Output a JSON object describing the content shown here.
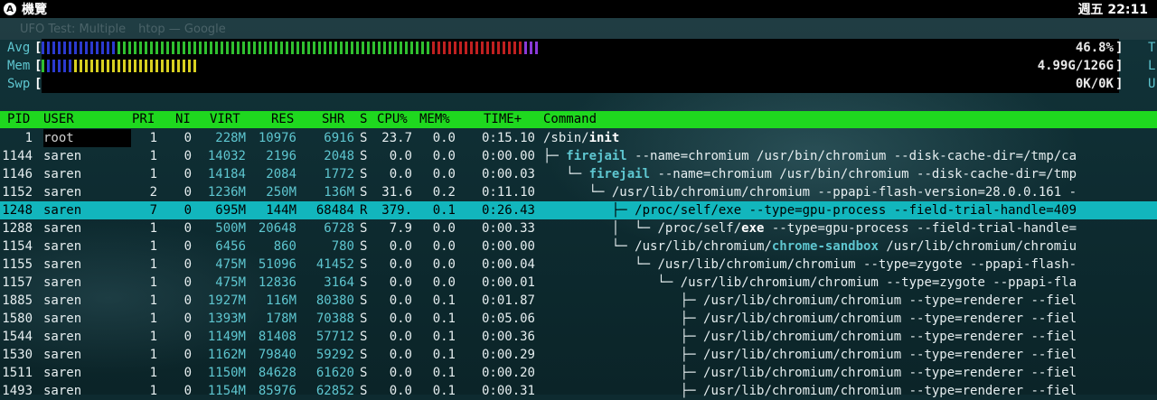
{
  "topbar": {
    "activities": "機覽",
    "clock": "週五 22:11"
  },
  "browser_ghost": {
    "tab1": "UFO Test: Multiple",
    "tab2": "htop — Google"
  },
  "meters": [
    {
      "label": "Avg",
      "value": "46.8%",
      "side": "T"
    },
    {
      "label": "Mem",
      "value": "4.99G/126G",
      "side": "L"
    },
    {
      "label": "Swp",
      "value": "0K/0K",
      "side": "U"
    }
  ],
  "meter_colors": {
    "avg": [
      {
        "color": "#2b3ad0",
        "n": 14
      },
      {
        "color": "#30c030",
        "n": 58
      },
      {
        "color": "#c02020",
        "n": 17
      },
      {
        "color": "#8a3ad8",
        "n": 3
      }
    ],
    "mem": [
      {
        "color": "#30c030",
        "n": 1
      },
      {
        "color": "#2b3ad0",
        "n": 5
      },
      {
        "color": "#d8d020",
        "n": 23
      }
    ],
    "swp": []
  },
  "columns": {
    "pid": "PID",
    "user": "USER",
    "pri": "PRI",
    "ni": "NI",
    "virt": "VIRT",
    "res": "RES",
    "shr": "SHR",
    "s": "S",
    "cpu": "CPU%",
    "mem": "MEM%",
    "time": "TIME+",
    "command": "Command"
  },
  "processes": [
    {
      "pid": "1",
      "user": "root",
      "pri": "1",
      "ni": "0",
      "virt": "228M",
      "res": "10976",
      "shr": "6916",
      "s": "S",
      "cpu": "23.7",
      "mem": "0.0",
      "time": "0:15.10",
      "tree": "",
      "cmd_pre": "/sbin/",
      "cmd_hi": "init",
      "cmd_post": ""
    },
    {
      "pid": "1144",
      "user": "saren",
      "pri": "1",
      "ni": "0",
      "virt": "14032",
      "res": "2196",
      "shr": "2048",
      "s": "S",
      "cpu": "0.0",
      "mem": "0.0",
      "time": "0:00.00",
      "tree": "├─ ",
      "cmd_pre": "",
      "cmd_hi": "firejail",
      "cmd_post": " --name=chromium /usr/bin/chromium --disk-cache-dir=/tmp/ca"
    },
    {
      "pid": "1146",
      "user": "saren",
      "pri": "1",
      "ni": "0",
      "virt": "14184",
      "res": "2084",
      "shr": "1772",
      "s": "S",
      "cpu": "0.0",
      "mem": "0.0",
      "time": "0:00.03",
      "tree": "   └─ ",
      "cmd_pre": "",
      "cmd_hi": "firejail",
      "cmd_post": " --name=chromium /usr/bin/chromium --disk-cache-dir=/tmp"
    },
    {
      "pid": "1152",
      "user": "saren",
      "pri": "2",
      "ni": "0",
      "virt": "1236M",
      "res": "250M",
      "shr": "136M",
      "s": "S",
      "cpu": "31.6",
      "mem": "0.2",
      "time": "0:11.10",
      "tree": "      └─ ",
      "cmd_pre": "/usr/lib/chromium/chromium --ppapi-flash-version=28.0.0.161 -",
      "cmd_hi": "",
      "cmd_post": ""
    },
    {
      "pid": "1248",
      "user": "saren",
      "pri": "7",
      "ni": "0",
      "virt": "695M",
      "res": "144M",
      "shr": "68484",
      "s": "R",
      "cpu": "379.",
      "mem": "0.1",
      "time": "0:26.43",
      "tree": "         ├─ ",
      "cmd_pre": "/proc/self/exe --type=gpu-process --field-trial-handle=409",
      "cmd_hi": "",
      "cmd_post": "",
      "selected": true
    },
    {
      "pid": "1288",
      "user": "saren",
      "pri": "1",
      "ni": "0",
      "virt": "500M",
      "res": "20648",
      "shr": "6728",
      "s": "S",
      "cpu": "7.9",
      "mem": "0.0",
      "time": "0:00.33",
      "tree": "         │  └─ ",
      "cmd_pre": "/proc/self/",
      "cmd_hi": "exe",
      "cmd_post": " --type=gpu-process --field-trial-handle="
    },
    {
      "pid": "1154",
      "user": "saren",
      "pri": "1",
      "ni": "0",
      "virt": "6456",
      "res": "860",
      "shr": "780",
      "s": "S",
      "cpu": "0.0",
      "mem": "0.0",
      "time": "0:00.00",
      "tree": "         └─ ",
      "cmd_pre": "/usr/lib/chromium/",
      "cmd_hi": "chrome-sandbox",
      "cmd_post": " /usr/lib/chromium/chromiu"
    },
    {
      "pid": "1155",
      "user": "saren",
      "pri": "1",
      "ni": "0",
      "virt": "475M",
      "res": "51096",
      "shr": "41452",
      "s": "S",
      "cpu": "0.0",
      "mem": "0.0",
      "time": "0:00.04",
      "tree": "            └─ ",
      "cmd_pre": "/usr/lib/chromium/chromium --type=zygote --ppapi-flash-",
      "cmd_hi": "",
      "cmd_post": ""
    },
    {
      "pid": "1157",
      "user": "saren",
      "pri": "1",
      "ni": "0",
      "virt": "475M",
      "res": "12836",
      "shr": "3164",
      "s": "S",
      "cpu": "0.0",
      "mem": "0.0",
      "time": "0:00.01",
      "tree": "               └─ ",
      "cmd_pre": "/usr/lib/chromium/chromium --type=zygote --ppapi-fla",
      "cmd_hi": "",
      "cmd_post": ""
    },
    {
      "pid": "1885",
      "user": "saren",
      "pri": "1",
      "ni": "0",
      "virt": "1927M",
      "res": "116M",
      "shr": "80380",
      "s": "S",
      "cpu": "0.0",
      "mem": "0.1",
      "time": "0:01.87",
      "tree": "                  ├─ ",
      "cmd_pre": "/usr/lib/chromium/chromium --type=renderer --fiel",
      "cmd_hi": "",
      "cmd_post": ""
    },
    {
      "pid": "1580",
      "user": "saren",
      "pri": "1",
      "ni": "0",
      "virt": "1393M",
      "res": "178M",
      "shr": "70388",
      "s": "S",
      "cpu": "0.0",
      "mem": "0.1",
      "time": "0:05.06",
      "tree": "                  ├─ ",
      "cmd_pre": "/usr/lib/chromium/chromium --type=renderer --fiel",
      "cmd_hi": "",
      "cmd_post": ""
    },
    {
      "pid": "1544",
      "user": "saren",
      "pri": "1",
      "ni": "0",
      "virt": "1149M",
      "res": "81408",
      "shr": "57712",
      "s": "S",
      "cpu": "0.0",
      "mem": "0.1",
      "time": "0:00.36",
      "tree": "                  ├─ ",
      "cmd_pre": "/usr/lib/chromium/chromium --type=renderer --fiel",
      "cmd_hi": "",
      "cmd_post": ""
    },
    {
      "pid": "1530",
      "user": "saren",
      "pri": "1",
      "ni": "0",
      "virt": "1162M",
      "res": "79840",
      "shr": "59292",
      "s": "S",
      "cpu": "0.0",
      "mem": "0.1",
      "time": "0:00.29",
      "tree": "                  ├─ ",
      "cmd_pre": "/usr/lib/chromium/chromium --type=renderer --fiel",
      "cmd_hi": "",
      "cmd_post": ""
    },
    {
      "pid": "1511",
      "user": "saren",
      "pri": "1",
      "ni": "0",
      "virt": "1150M",
      "res": "84628",
      "shr": "61620",
      "s": "S",
      "cpu": "0.0",
      "mem": "0.1",
      "time": "0:00.20",
      "tree": "                  ├─ ",
      "cmd_pre": "/usr/lib/chromium/chromium --type=renderer --fiel",
      "cmd_hi": "",
      "cmd_post": ""
    },
    {
      "pid": "1493",
      "user": "saren",
      "pri": "1",
      "ni": "0",
      "virt": "1154M",
      "res": "85976",
      "shr": "62852",
      "s": "S",
      "cpu": "0.0",
      "mem": "0.1",
      "time": "0:00.31",
      "tree": "                  ├─ ",
      "cmd_pre": "/usr/lib/chromium/chromium --type=renderer --fiel",
      "cmd_hi": "",
      "cmd_post": ""
    }
  ]
}
